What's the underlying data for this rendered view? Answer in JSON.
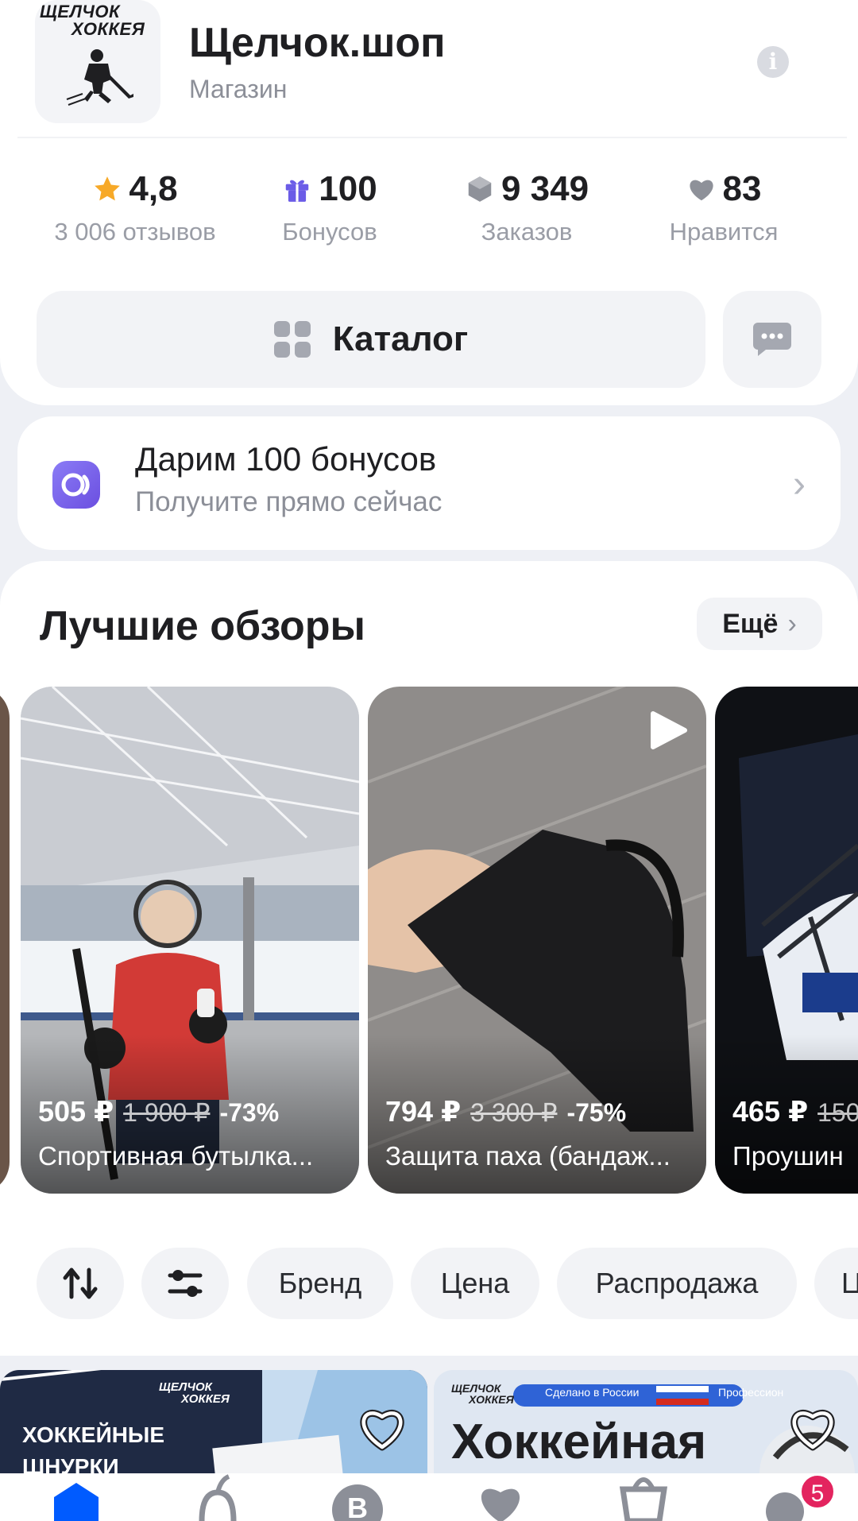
{
  "store": {
    "name": "Щелчок.шоп",
    "type": "Магазин",
    "logo_text_line1": "ЩЕЛЧОК",
    "logo_text_line2": "ХОККЕЯ"
  },
  "stats": [
    {
      "icon": "star-icon",
      "value": "4,8",
      "label": "3 006 отзывов",
      "color": "#f7a928"
    },
    {
      "icon": "gift-icon",
      "value": "100",
      "label": "Бонусов",
      "color": "#6b5ce7"
    },
    {
      "icon": "box-icon",
      "value": "9 349",
      "label": "Заказов",
      "color": "#8e9199"
    },
    {
      "icon": "heart-icon",
      "value": "83",
      "label": "Нравится",
      "color": "#8e9199"
    }
  ],
  "catalog_button": {
    "label": "Каталог"
  },
  "promo": {
    "title": "Дарим 100 бонусов",
    "subtitle": "Получите прямо сейчас"
  },
  "reviews": {
    "title": "Лучшие обзоры",
    "more_label": "Ещё",
    "items": [
      {
        "price": "505 ₽",
        "old_price": "1 900 ₽",
        "discount": "-73%",
        "name": "Спортивная бутылка..."
      },
      {
        "price": "794 ₽",
        "old_price": "3 300 ₽",
        "discount": "-75%",
        "name": "Защита паха (бандаж..."
      },
      {
        "price": "465 ₽",
        "old_price": "150",
        "discount": "",
        "name": "Проушин"
      }
    ]
  },
  "filters": {
    "chips": [
      "Бренд",
      "Цена",
      "Распродажа",
      "Ц"
    ]
  },
  "products": [
    {
      "title_line1": "ХОККЕЙНЫЕ",
      "title_line2": "ШНУРКИ",
      "brand_line1": "ЩЕЛЧОК",
      "brand_line2": "ХОККЕЯ"
    },
    {
      "title_line1": "Хоккейная",
      "brand_line1": "ЩЕЛЧОК",
      "brand_line2": "ХОККЕЯ",
      "tag_made": "Сделано в России",
      "tag_prof": "Профессион"
    }
  ],
  "nav": {
    "cart_badge": "5"
  },
  "colors": {
    "accent": "#005bff",
    "badge": "#e3245f",
    "promo_icon": "#7b63ee"
  }
}
